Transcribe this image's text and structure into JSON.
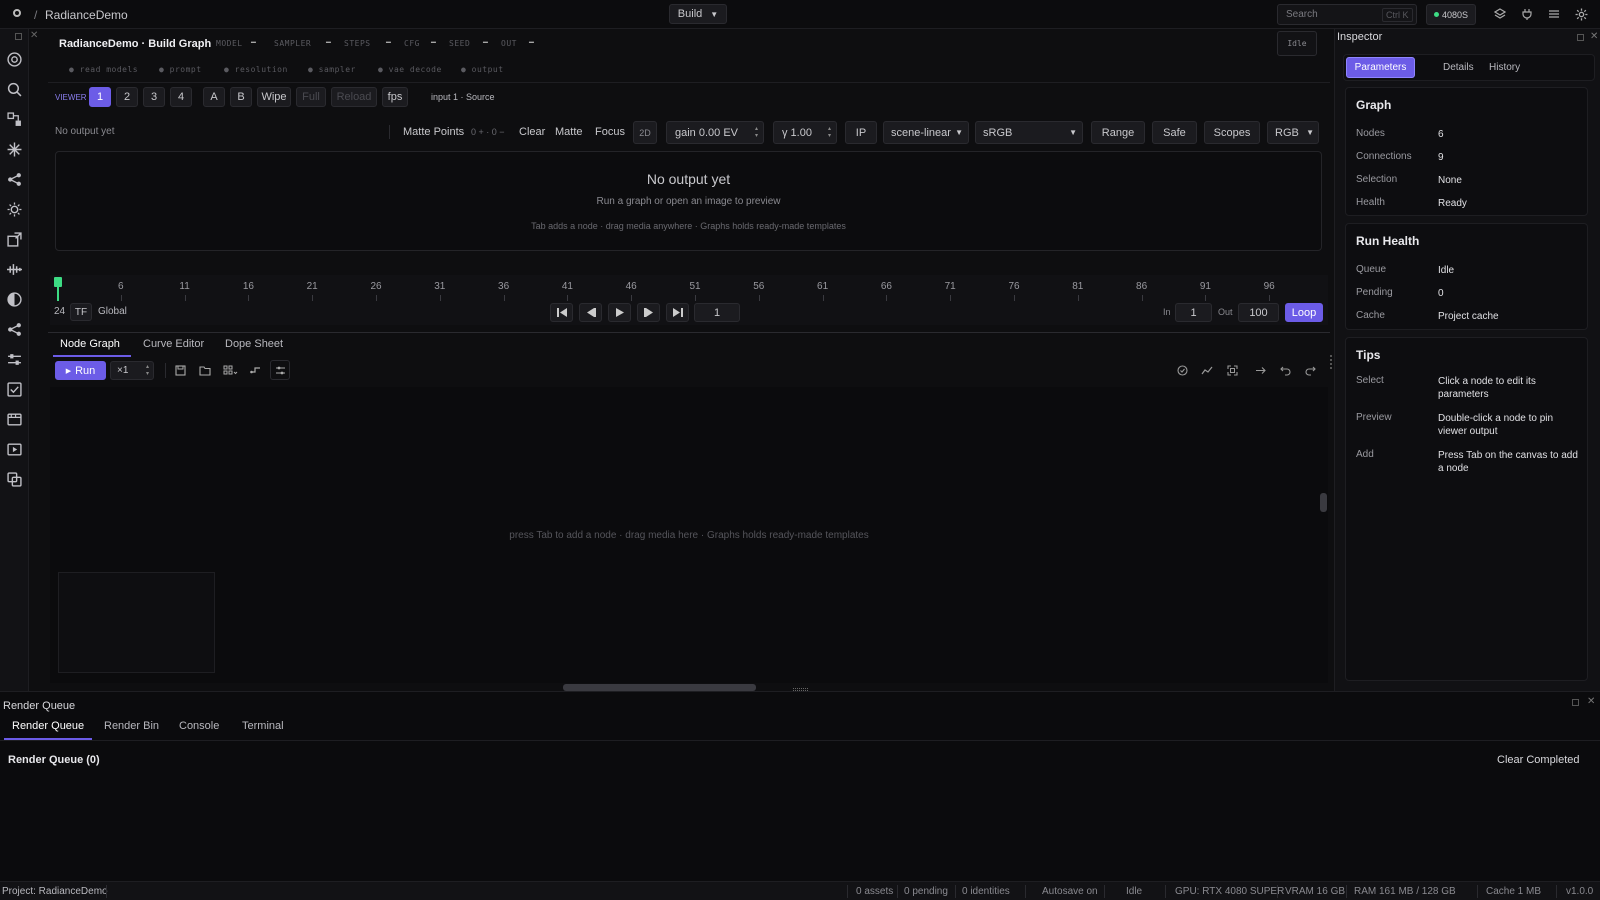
{
  "topbar": {
    "breadcrumb_sep": "/",
    "project": "RadianceDemo",
    "mode": "Build",
    "search_placeholder": "Search",
    "search_shortcut": "Ctrl K",
    "gpu_badge": "4080S"
  },
  "graph": {
    "title": "RadianceDemo · Build Graph",
    "pipeline": [
      "MODEL",
      "SAMPLER",
      "STEPS",
      "CFG",
      "SEED",
      "OUT"
    ],
    "status": "Idle",
    "stages": [
      "read models",
      "prompt",
      "resolution",
      "sampler",
      "vae decode",
      "output"
    ]
  },
  "viewer": {
    "label": "VIEWER",
    "slots": [
      "1",
      "2",
      "3",
      "4"
    ],
    "ab": [
      "A",
      "B"
    ],
    "wipe": "Wipe",
    "full": "Full",
    "reload": "Reload",
    "fps": "fps",
    "source": "input 1 · Source",
    "no_output_small": "No output yet",
    "matte_points": "Matte Points",
    "matte_count": "0 + · 0 −",
    "clear": "Clear",
    "matte": "Matte",
    "focus": "Focus",
    "mode2d": "2D",
    "gain": "gain 0.00 EV",
    "gamma": "γ 1.00",
    "ip": "IP",
    "colorspace": "scene-linear",
    "display": "sRGB",
    "range": "Range",
    "safe": "Safe",
    "scopes": "Scopes",
    "channel": "RGB",
    "empty_title": "No output yet",
    "empty_sub": "Run a graph or open an image to preview",
    "empty_hint": "Tab adds a node · drag media anywhere · Graphs holds ready-made templates"
  },
  "timeline": {
    "ticks": [
      "1",
      "6",
      "11",
      "16",
      "21",
      "26",
      "31",
      "36",
      "41",
      "46",
      "51",
      "56",
      "61",
      "66",
      "71",
      "76",
      "81",
      "86",
      "91",
      "96"
    ],
    "fps": "24",
    "tf": "TF",
    "global": "Global",
    "frame": "1",
    "in_label": "In",
    "in_value": "1",
    "out_label": "Out",
    "out_value": "100",
    "loop": "Loop"
  },
  "editor_tabs": [
    "Node Graph",
    "Curve Editor",
    "Dope Sheet"
  ],
  "toolbar": {
    "run": "Run",
    "multiplier": "×1"
  },
  "canvas_hint": "press Tab to add a node · drag media here · Graphs holds ready-made templates",
  "inspector": {
    "title": "Inspector",
    "tabs": [
      "Parameters",
      "Details",
      "History"
    ],
    "graph": {
      "title": "Graph",
      "rows": [
        {
          "k": "Nodes",
          "v": "6"
        },
        {
          "k": "Connections",
          "v": "9"
        },
        {
          "k": "Selection",
          "v": "None"
        },
        {
          "k": "Health",
          "v": "Ready"
        }
      ]
    },
    "run_health": {
      "title": "Run Health",
      "rows": [
        {
          "k": "Queue",
          "v": "Idle"
        },
        {
          "k": "Pending",
          "v": "0"
        },
        {
          "k": "Cache",
          "v": "Project cache"
        }
      ]
    },
    "tips": {
      "title": "Tips",
      "rows": [
        {
          "k": "Select",
          "v": "Click a node to edit its parameters"
        },
        {
          "k": "Preview",
          "v": "Double-click a node to pin viewer output"
        },
        {
          "k": "Add",
          "v": "Press Tab on the canvas to add a node"
        }
      ]
    }
  },
  "render_queue": {
    "title": "Render Queue",
    "tabs": [
      "Render Queue",
      "Render Bin",
      "Console",
      "Terminal"
    ],
    "heading": "Render Queue (0)",
    "clear_completed": "Clear Completed"
  },
  "statusbar": {
    "project": "Project: RadianceDemo",
    "assets": "0 assets",
    "pending": "0 pending",
    "identities": "0 identities",
    "autosave": "Autosave on",
    "state": "Idle",
    "gpu": "GPU: RTX 4080 SUPER",
    "vram": "VRAM 16 GB",
    "ram": "RAM 161 MB / 128 GB",
    "cache": "Cache 1 MB",
    "version": "v1.0.0"
  },
  "colors": {
    "accent": "#6c5ce7",
    "playhead": "#3ddc84",
    "gpu_dot": "#3ddc84"
  }
}
